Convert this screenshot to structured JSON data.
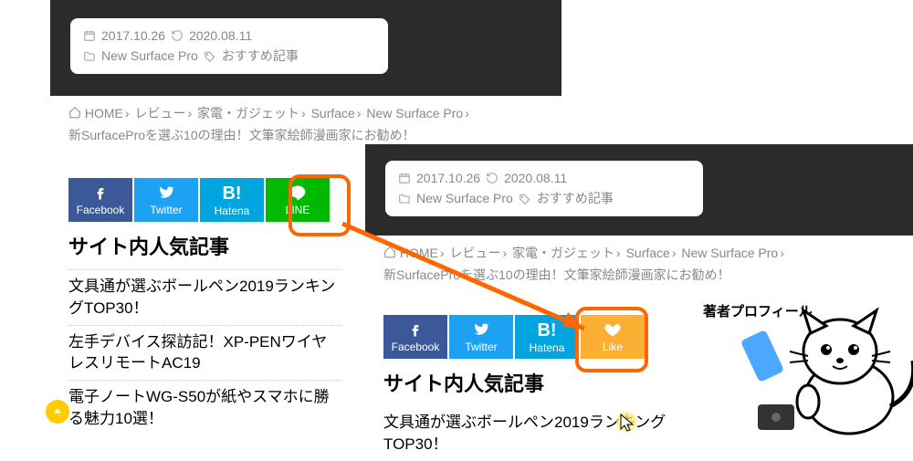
{
  "meta": {
    "date": "2017.10.26",
    "updated": "2020.08.11",
    "category": "New Surface Pro",
    "tag": "おすすめ記事"
  },
  "crumbs": {
    "home": "HOME",
    "c1": "レビュー",
    "c2": "家電・ガジェット",
    "c3": "Surface",
    "c4": "New Surface Pro",
    "title": "新SurfaceProを選ぶ10の理由！文筆家絵師漫画家にお勧め！"
  },
  "share": {
    "facebook": "Facebook",
    "twitter": "Twitter",
    "hatena": "Hatena",
    "line": "LINE",
    "like": "Like"
  },
  "section": "サイト内人気記事",
  "articles": [
    "文具通が選ぶボールペン2019ランキングTOP30！",
    "左手デバイス探訪記！XP-PENワイヤレスリモートAC19",
    "電子ノートWG-S50が紙やスマホに勝る魅力10選！"
  ],
  "sidebar": {
    "author": "著者プロフィール"
  },
  "hatena_mark": "B!"
}
